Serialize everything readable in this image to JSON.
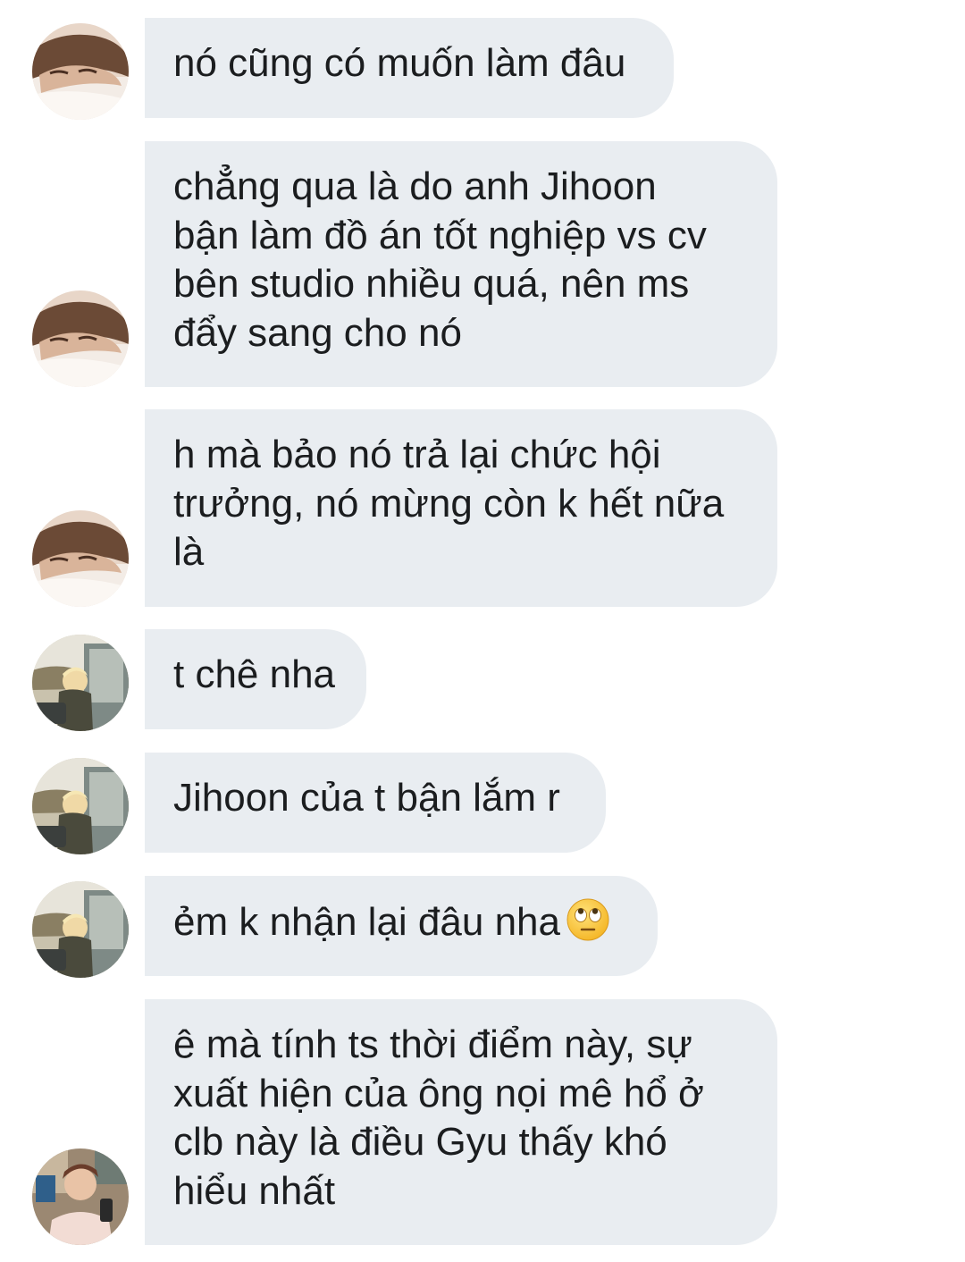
{
  "messages": [
    {
      "avatar": "sleeping-boy-avatar",
      "lines": [
        "nó cũng có muốn làm đâu"
      ]
    },
    {
      "avatar": "sleeping-boy-avatar",
      "lines": [
        "chẳng qua là do anh Jihoon",
        "bận làm đồ án tốt nghiệp vs cv",
        "bên studio nhiều quá, nên ms",
        "đẩy sang cho nó"
      ]
    },
    {
      "avatar": "sleeping-boy-avatar",
      "lines": [
        "h mà bảo nó trả lại chức hội",
        "trưởng, nó mừng còn k hết nữa",
        "là"
      ]
    },
    {
      "avatar": "car-window-avatar",
      "lines": [
        "t chê nha"
      ]
    },
    {
      "avatar": "car-window-avatar",
      "lines": [
        "Jihoon của t bận lắm r"
      ]
    },
    {
      "avatar": "car-window-avatar",
      "lines": [
        "ẻm k nhận lại đâu nha"
      ],
      "emoji": "eye-roll-emoji"
    },
    {
      "avatar": "selfie-avatar",
      "lines": [
        "ê mà tính ts thời điểm này, sự",
        "xuất hiện của ông nọi mê hổ ở",
        "clb này là điều Gyu thấy khó",
        "hiểu nhất"
      ]
    }
  ],
  "colors": {
    "bubble": "#e9edf1",
    "text": "#1b1d1f",
    "background": "#ffffff"
  }
}
